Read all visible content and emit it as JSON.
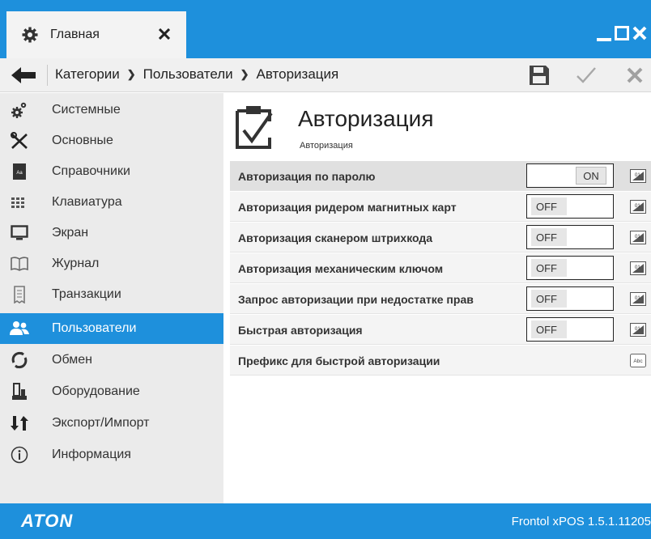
{
  "tab": {
    "label": "Главная",
    "icon": "gear-icon"
  },
  "window": {
    "minimize_icon": "minimize-icon",
    "maximize_icon": "maximize-icon",
    "close_icon": "close-icon"
  },
  "breadcrumb": [
    "Категории",
    "Пользователи",
    "Авторизация"
  ],
  "toolbar": {
    "save_icon": "save-icon",
    "apply_icon": "check-icon",
    "cancel_icon": "cancel-icon"
  },
  "sidebar": {
    "items": [
      {
        "label": "Системные",
        "icon": "system-gears-icon"
      },
      {
        "label": "Основные",
        "icon": "tools-icon"
      },
      {
        "label": "Справочники",
        "icon": "reference-book-icon"
      },
      {
        "label": "Клавиатура",
        "icon": "keyboard-icon"
      },
      {
        "label": "Экран",
        "icon": "monitor-icon"
      },
      {
        "label": "Журнал",
        "icon": "journal-icon"
      },
      {
        "label": "Транзакции",
        "icon": "receipt-icon"
      },
      {
        "label": "Пользователи",
        "icon": "users-icon",
        "active": true
      },
      {
        "label": "Обмен",
        "icon": "exchange-icon"
      },
      {
        "label": "Оборудование",
        "icon": "equipment-icon"
      },
      {
        "label": "Экспорт/Импорт",
        "icon": "export-import-icon"
      },
      {
        "label": "Информация",
        "icon": "info-icon"
      }
    ]
  },
  "page": {
    "title": "Авторизация",
    "subtitle": "Авторизация",
    "icon": "clipboard-check-icon"
  },
  "settings": [
    {
      "label": "Авторизация по паролю",
      "value": "ON",
      "editor_icon": "keyboard-numeric-icon"
    },
    {
      "label": "Авторизация ридером магнитных карт",
      "value": "OFF",
      "editor_icon": "keyboard-numeric-icon"
    },
    {
      "label": "Авторизация сканером штрихкода",
      "value": "OFF",
      "editor_icon": "keyboard-numeric-icon"
    },
    {
      "label": "Авторизация механическим ключом",
      "value": "OFF",
      "editor_icon": "keyboard-numeric-icon"
    },
    {
      "label": "Запрос авторизации при недостатке прав",
      "value": "OFF",
      "editor_icon": "keyboard-numeric-icon"
    },
    {
      "label": "Быстрая авторизация",
      "value": "OFF",
      "editor_icon": "keyboard-numeric-icon"
    },
    {
      "label": "Префикс для быстрой авторизации",
      "value": "",
      "editor_icon": "keyboard-text-icon",
      "editor_text": "Abc"
    }
  ],
  "footer": {
    "logo": "ATON",
    "version": "Frontol xPOS 1.5.1.11205"
  },
  "colors": {
    "accent": "#1e90dc",
    "sidebar_bg": "#ebebeb",
    "row_bg": "#f4f4f4",
    "row_highlight": "#e0e0e0"
  }
}
